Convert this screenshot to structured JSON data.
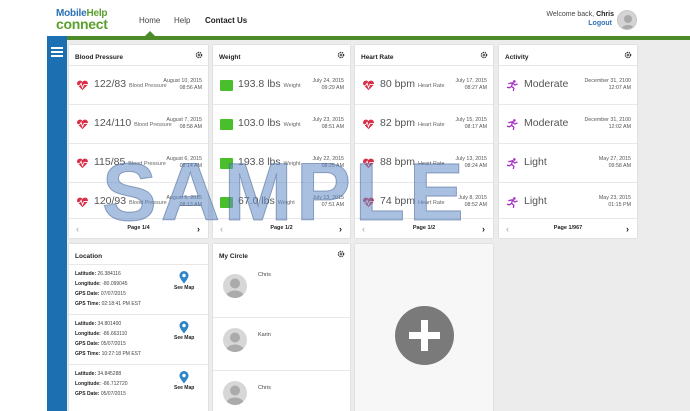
{
  "header": {
    "logo_top_a": "Mobile",
    "logo_top_b": "Help",
    "logo_bottom": "connect",
    "nav": [
      "Home",
      "Help",
      "Contact Us"
    ],
    "welcome_prefix": "Welcome back,",
    "welcome_name": "Chris",
    "logout": "Logout"
  },
  "colors": {
    "brand_blue": "#1c6fb0",
    "brand_green": "#4c8a2a",
    "heart_red": "#d9304a",
    "scale_green": "#49c02b",
    "activity_purple": "#a32fc4"
  },
  "blood_pressure": {
    "title": "Blood Pressure",
    "rows": [
      {
        "value": "122/83",
        "unit": "Blood Pressure",
        "date": "August 10, 2015",
        "time": "08:56 AM"
      },
      {
        "value": "124/110",
        "unit": "Blood Pressure",
        "date": "August 7, 2015",
        "time": "08:58 AM"
      },
      {
        "value": "115/85",
        "unit": "Blood Pressure",
        "date": "August 6, 2015",
        "time": "08:14 AM"
      },
      {
        "value": "120/93",
        "unit": "Blood Pressure",
        "date": "August 5, 2015",
        "time": "08:13 AM"
      }
    ],
    "pager": "Page 1/4"
  },
  "weight": {
    "title": "Weight",
    "rows": [
      {
        "value": "193.8 lbs",
        "unit": "Weight",
        "date": "July 24, 2015",
        "time": "09:29 AM"
      },
      {
        "value": "103.0 lbs",
        "unit": "Weight",
        "date": "July 23, 2015",
        "time": "08:51 AM"
      },
      {
        "value": "193.8 lbs",
        "unit": "Weight",
        "date": "July 22, 2015",
        "time": "08:25 AM"
      },
      {
        "value": "67.0 lbs",
        "unit": "Weight",
        "date": "July 13, 2015",
        "time": "07:51 AM"
      }
    ],
    "pager": "Page 1/2"
  },
  "heart_rate": {
    "title": "Heart Rate",
    "rows": [
      {
        "value": "80 bpm",
        "unit": "Heart Rate",
        "date": "July 17, 2015",
        "time": "08:27 AM"
      },
      {
        "value": "82 bpm",
        "unit": "Heart Rate",
        "date": "July 15, 2015",
        "time": "08:17 AM"
      },
      {
        "value": "88 bpm",
        "unit": "Heart Rate",
        "date": "July 13, 2015",
        "time": "08:24 AM"
      },
      {
        "value": "74 bpm",
        "unit": "Heart Rate",
        "date": "July 8, 2015",
        "time": "08:52 AM"
      }
    ],
    "pager": "Page 1/2"
  },
  "activity": {
    "title": "Activity",
    "rows": [
      {
        "value": "Moderate",
        "date": "December 31, 2100",
        "time": "12:07 AM"
      },
      {
        "value": "Moderate",
        "date": "December 31, 2100",
        "time": "12:02 AM"
      },
      {
        "value": "Light",
        "date": "May 27, 2015",
        "time": "09:58 AM"
      },
      {
        "value": "Light",
        "date": "May 23, 2015",
        "time": "01:15 PM"
      }
    ],
    "pager": "Page 1/967"
  },
  "location": {
    "title": "Location",
    "labels": {
      "lat": "Latitude:",
      "lon": "Longitude:",
      "date": "GPS Date:",
      "time": "GPS Time:"
    },
    "see_map": "See Map",
    "rows": [
      {
        "lat": "26.384116",
        "lon": "-80.099045",
        "date": "07/07/2015",
        "time": "02:18:41 PM EST"
      },
      {
        "lat": "34.801400",
        "lon": "-86.663110",
        "date": "05/07/2015",
        "time": "10:27:18 PM EST"
      },
      {
        "lat": "34.845288",
        "lon": "-86.712720",
        "date": "05/07/2015",
        "time": ""
      }
    ]
  },
  "circle": {
    "title": "My Circle",
    "members": [
      "Chris",
      "Karin",
      "Chris"
    ]
  },
  "watermark": "SAMPLE"
}
